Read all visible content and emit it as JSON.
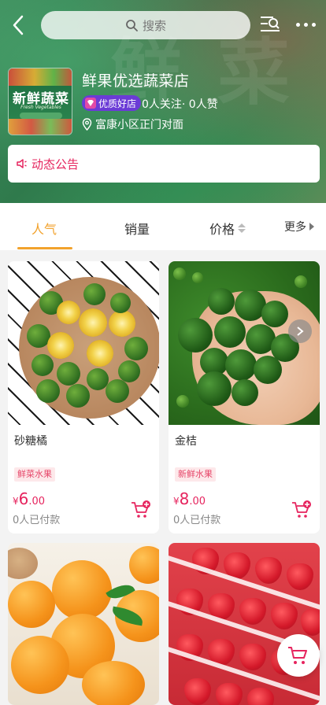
{
  "header": {
    "search_placeholder": "搜索",
    "icons": [
      "back-arrow-icon",
      "search-icon",
      "category-search-icon",
      "more-dots-icon"
    ]
  },
  "store": {
    "name": "鲜果优选蔬菜店",
    "badge": "优质好店",
    "stats": "0人关注· 0人赞",
    "address": "富康小区正门对面",
    "logo_title": "新鲜蔬菜",
    "logo_subtitle": "Fresh Vegetables"
  },
  "notice": {
    "label": "动态公告"
  },
  "tabs": [
    {
      "label": "人气",
      "active": true
    },
    {
      "label": "销量",
      "active": false
    },
    {
      "label": "价格",
      "active": false
    },
    {
      "label": "更多",
      "active": false
    }
  ],
  "products": [
    {
      "name": "砂糖橘",
      "tag": "鲜菜水果",
      "price_symbol": "¥",
      "price_int": "6",
      "price_dec": ".00",
      "sold": "0人已付款"
    },
    {
      "name": "金桔",
      "tag": "新鲜水果",
      "price_symbol": "¥",
      "price_int": "8",
      "price_dec": ".00",
      "sold": "0人已付款"
    },
    {
      "name": "",
      "tag": "",
      "price_symbol": "",
      "price_int": "",
      "price_dec": "",
      "sold": ""
    },
    {
      "name": "",
      "tag": "",
      "price_symbol": "",
      "price_int": "",
      "price_dec": "",
      "sold": ""
    }
  ],
  "colors": {
    "accent": "#f2a22c",
    "price": "#e6245e",
    "badge": "#6b3bd6",
    "tag_bg": "#fde8ea"
  }
}
